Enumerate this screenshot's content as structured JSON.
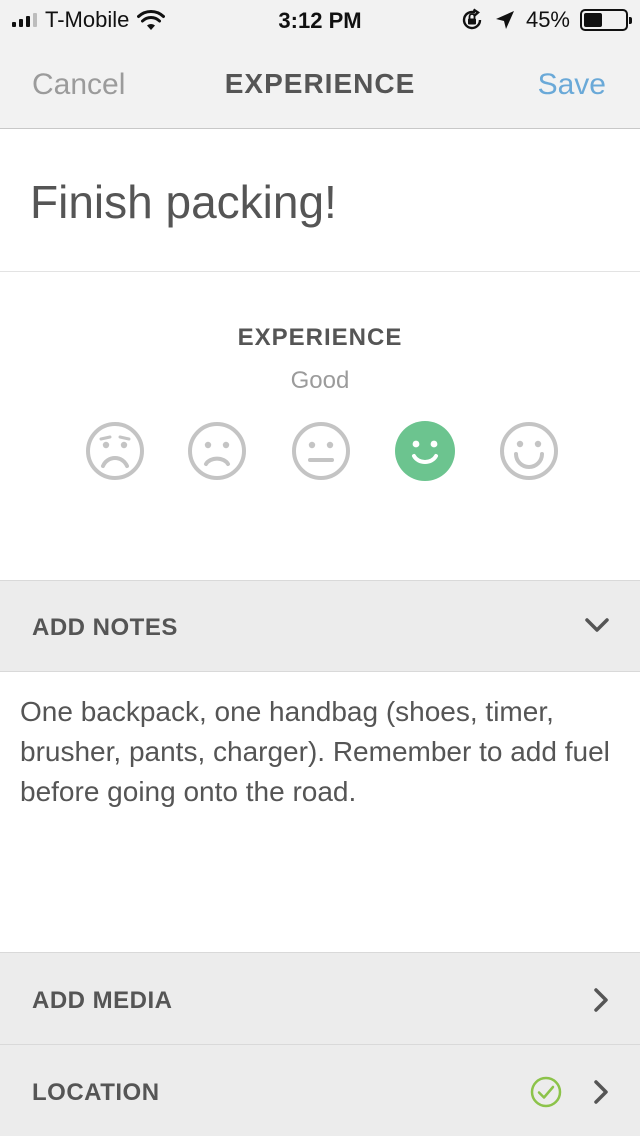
{
  "status_bar": {
    "carrier": "T-Mobile",
    "time": "3:12 PM",
    "battery_percent": "45%",
    "battery_level": 0.45,
    "icons": [
      "signal-icon",
      "wifi-icon",
      "orientation-lock-icon",
      "location-arrow-icon",
      "battery-icon"
    ]
  },
  "nav": {
    "cancel_label": "Cancel",
    "title": "EXPERIENCE",
    "save_label": "Save",
    "save_color": "#6aa9d8"
  },
  "item": {
    "title": "Finish packing!"
  },
  "experience": {
    "heading": "EXPERIENCE",
    "selected_label": "Good",
    "selected_index": 3,
    "selected_color": "#6cc48f",
    "faces": [
      "very-sad-face-icon",
      "sad-face-icon",
      "neutral-face-icon",
      "happy-face-icon",
      "very-happy-face-icon"
    ]
  },
  "notes": {
    "header_label": "ADD NOTES",
    "text": "One backpack, one handbag (shoes, timer, brusher, pants, charger). Remember to add fuel before going onto the road."
  },
  "media": {
    "label": "ADD MEDIA"
  },
  "location": {
    "label": "LOCATION",
    "set": true,
    "check_color": "#8cc34a"
  }
}
